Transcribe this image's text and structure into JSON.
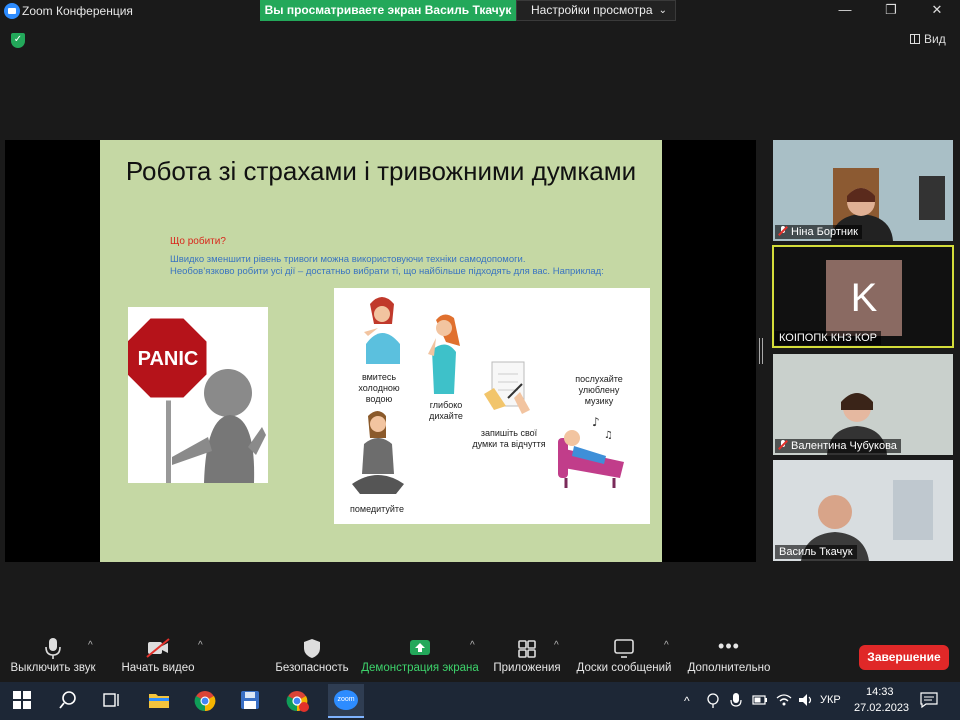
{
  "window": {
    "app_title": "Zoom Конференция",
    "share_banner": "Вы просматриваете экран Василь Ткачук",
    "view_settings": "Настройки просмотра",
    "view_label": "Вид"
  },
  "slide": {
    "title": "Робота зі страхами і тривожними думками",
    "question": "Що робити?",
    "body_line1": "Швидко зменшити рівень тривоги можна використовуючи техніки самодопомоги.",
    "body_line2": "Необов’язково робити усі дії – достатньо вибрати ті, що найбільше підходять для вас. Наприклад:",
    "panic_sign": "PANIC",
    "tips": {
      "wash": "вмитесь холодною водою",
      "breathe": "глибоко дихайте",
      "write": "запишіть свої думки та відчуття",
      "music": "послухайте улюблену музику",
      "meditate": "помедитуйте"
    }
  },
  "participants": [
    {
      "name": "Ніна Бортник",
      "muted": true
    },
    {
      "name": "КОІПОПК КНЗ КОР",
      "initial": "K",
      "active": true
    },
    {
      "name": "Валентина Чубукова",
      "muted": true
    },
    {
      "name": "Василь Ткачук",
      "muted": false
    }
  ],
  "toolbar": {
    "mute": "Выключить звук",
    "video": "Начать видео",
    "security": "Безопасность",
    "share": "Демонстрация экрана",
    "apps": "Приложения",
    "whiteboards": "Доски сообщений",
    "more": "Дополнительно",
    "end": "Завершение"
  },
  "taskbar": {
    "language": "УКР",
    "time": "14:33",
    "date": "27.02.2023",
    "zoom_label": "zoom"
  },
  "colors": {
    "share_green": "#23a85a",
    "end_red": "#e02828",
    "active_speaker": "#d4dd3a",
    "slide_bg": "#c5d8a4"
  }
}
